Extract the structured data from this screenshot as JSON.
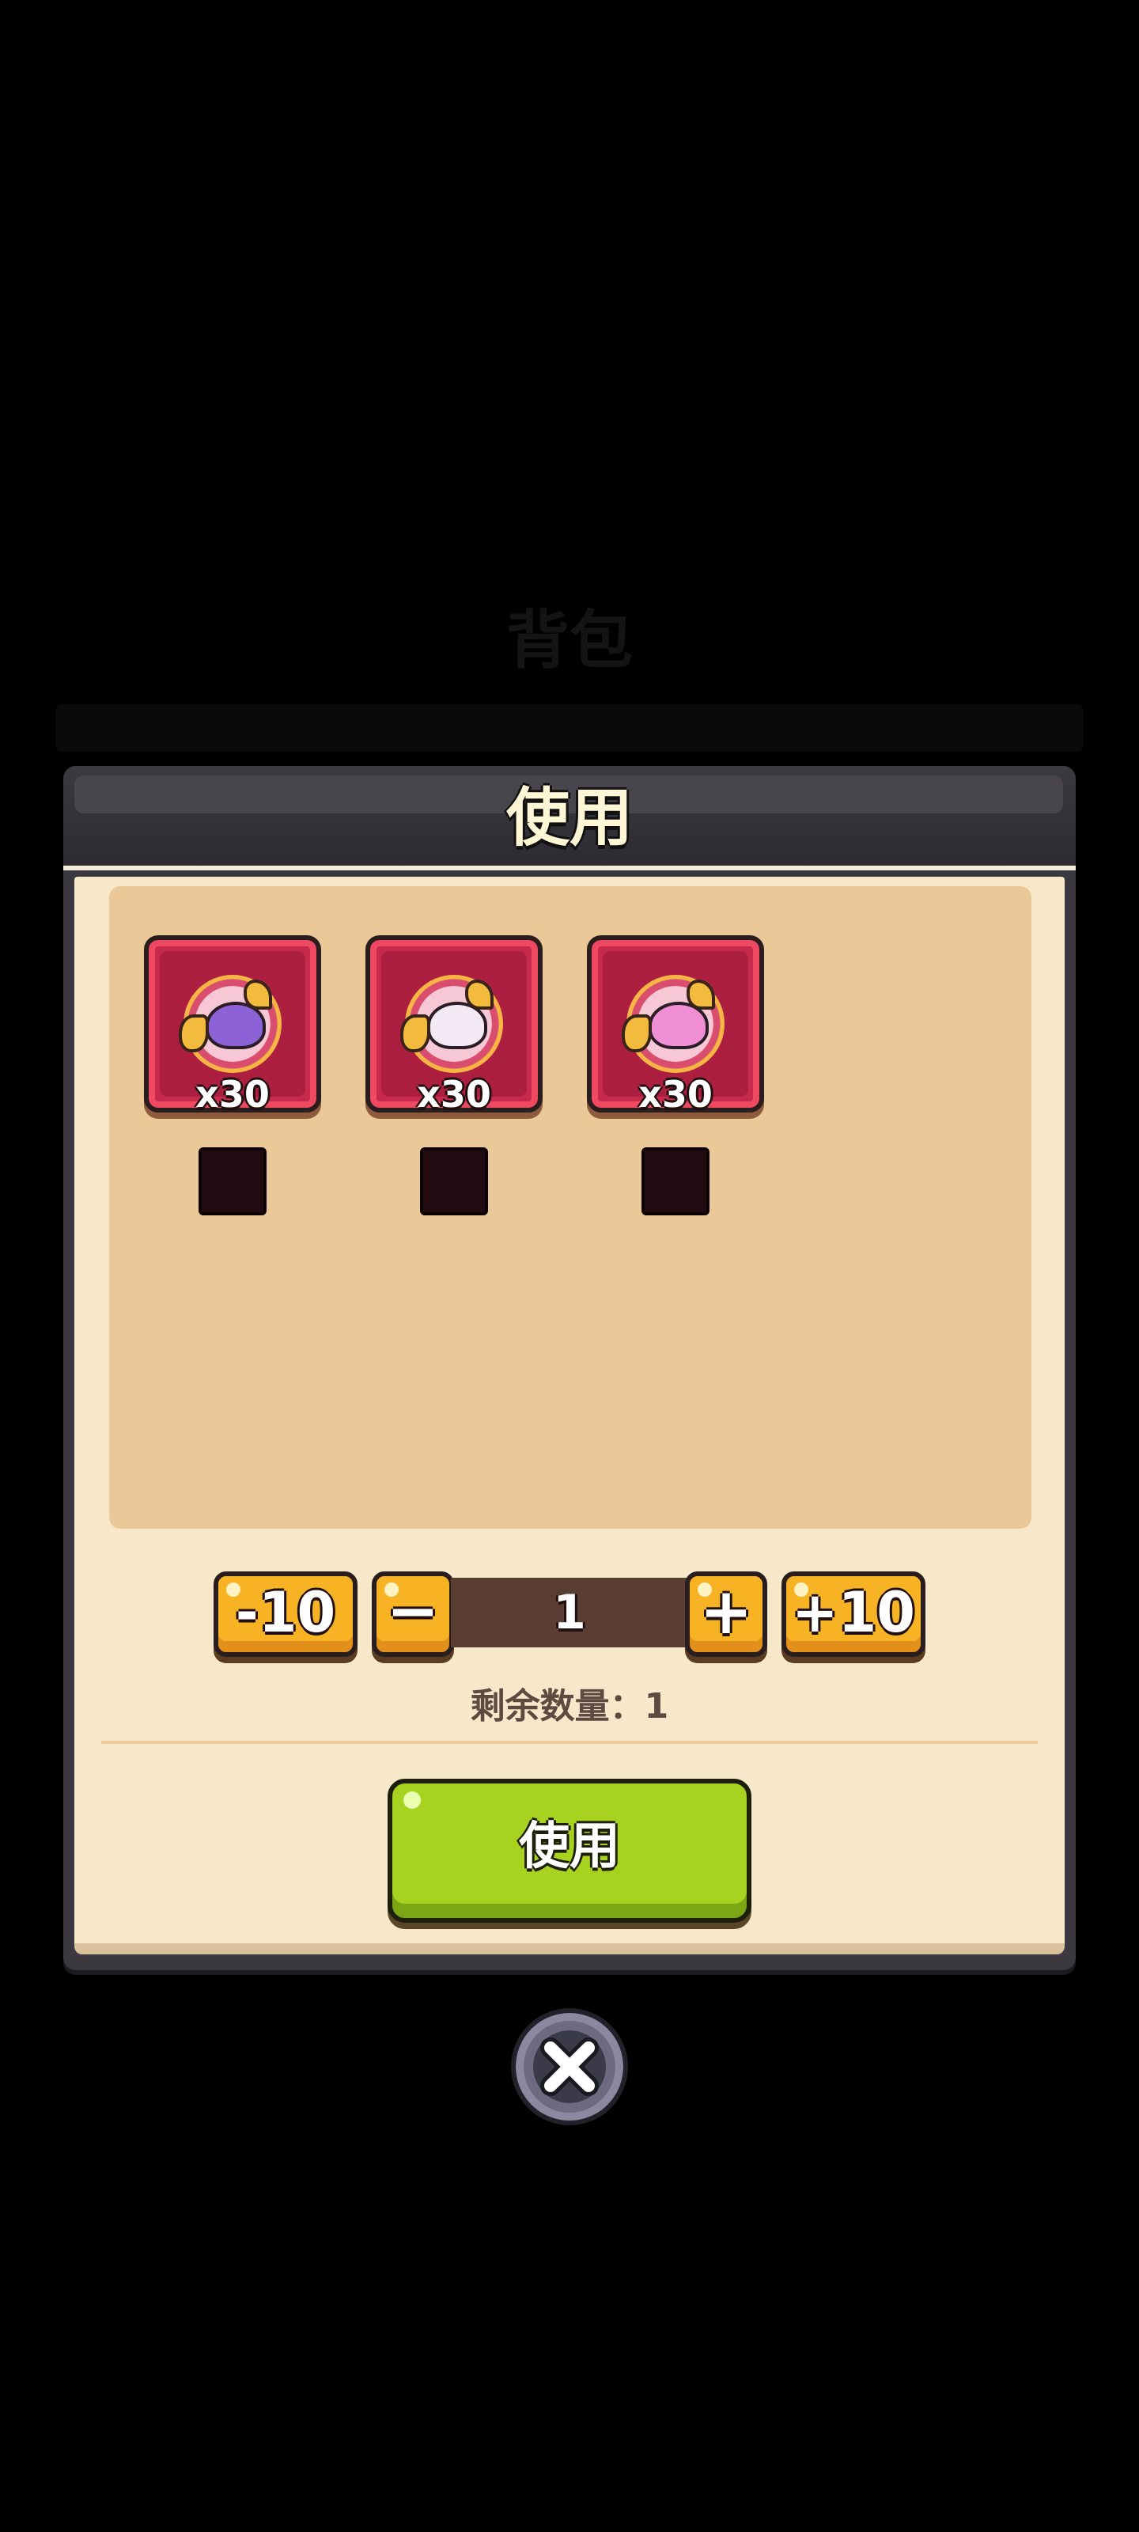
{
  "background": {
    "title": "背包"
  },
  "modal": {
    "title": "使用",
    "items": [
      {
        "count": "x30",
        "icon": "purple-dragon-medal-icon",
        "color": "#8c62d6"
      },
      {
        "count": "x30",
        "icon": "unicorn-medal-icon",
        "color": "#f3eaf6"
      },
      {
        "count": "x30",
        "icon": "pink-beast-medal-icon",
        "color": "#f08ed6"
      }
    ],
    "stepper": {
      "minus10_label": "-10",
      "minus_label": "−",
      "quantity": "1",
      "plus_label": "+",
      "plus10_label": "+10"
    },
    "remaining_text": "剩余数量：1",
    "use_button_label": "使用"
  },
  "colors": {
    "use_button": "#a7d320",
    "stepper_button": "#f7b324",
    "item_card": "#c82a4d"
  }
}
